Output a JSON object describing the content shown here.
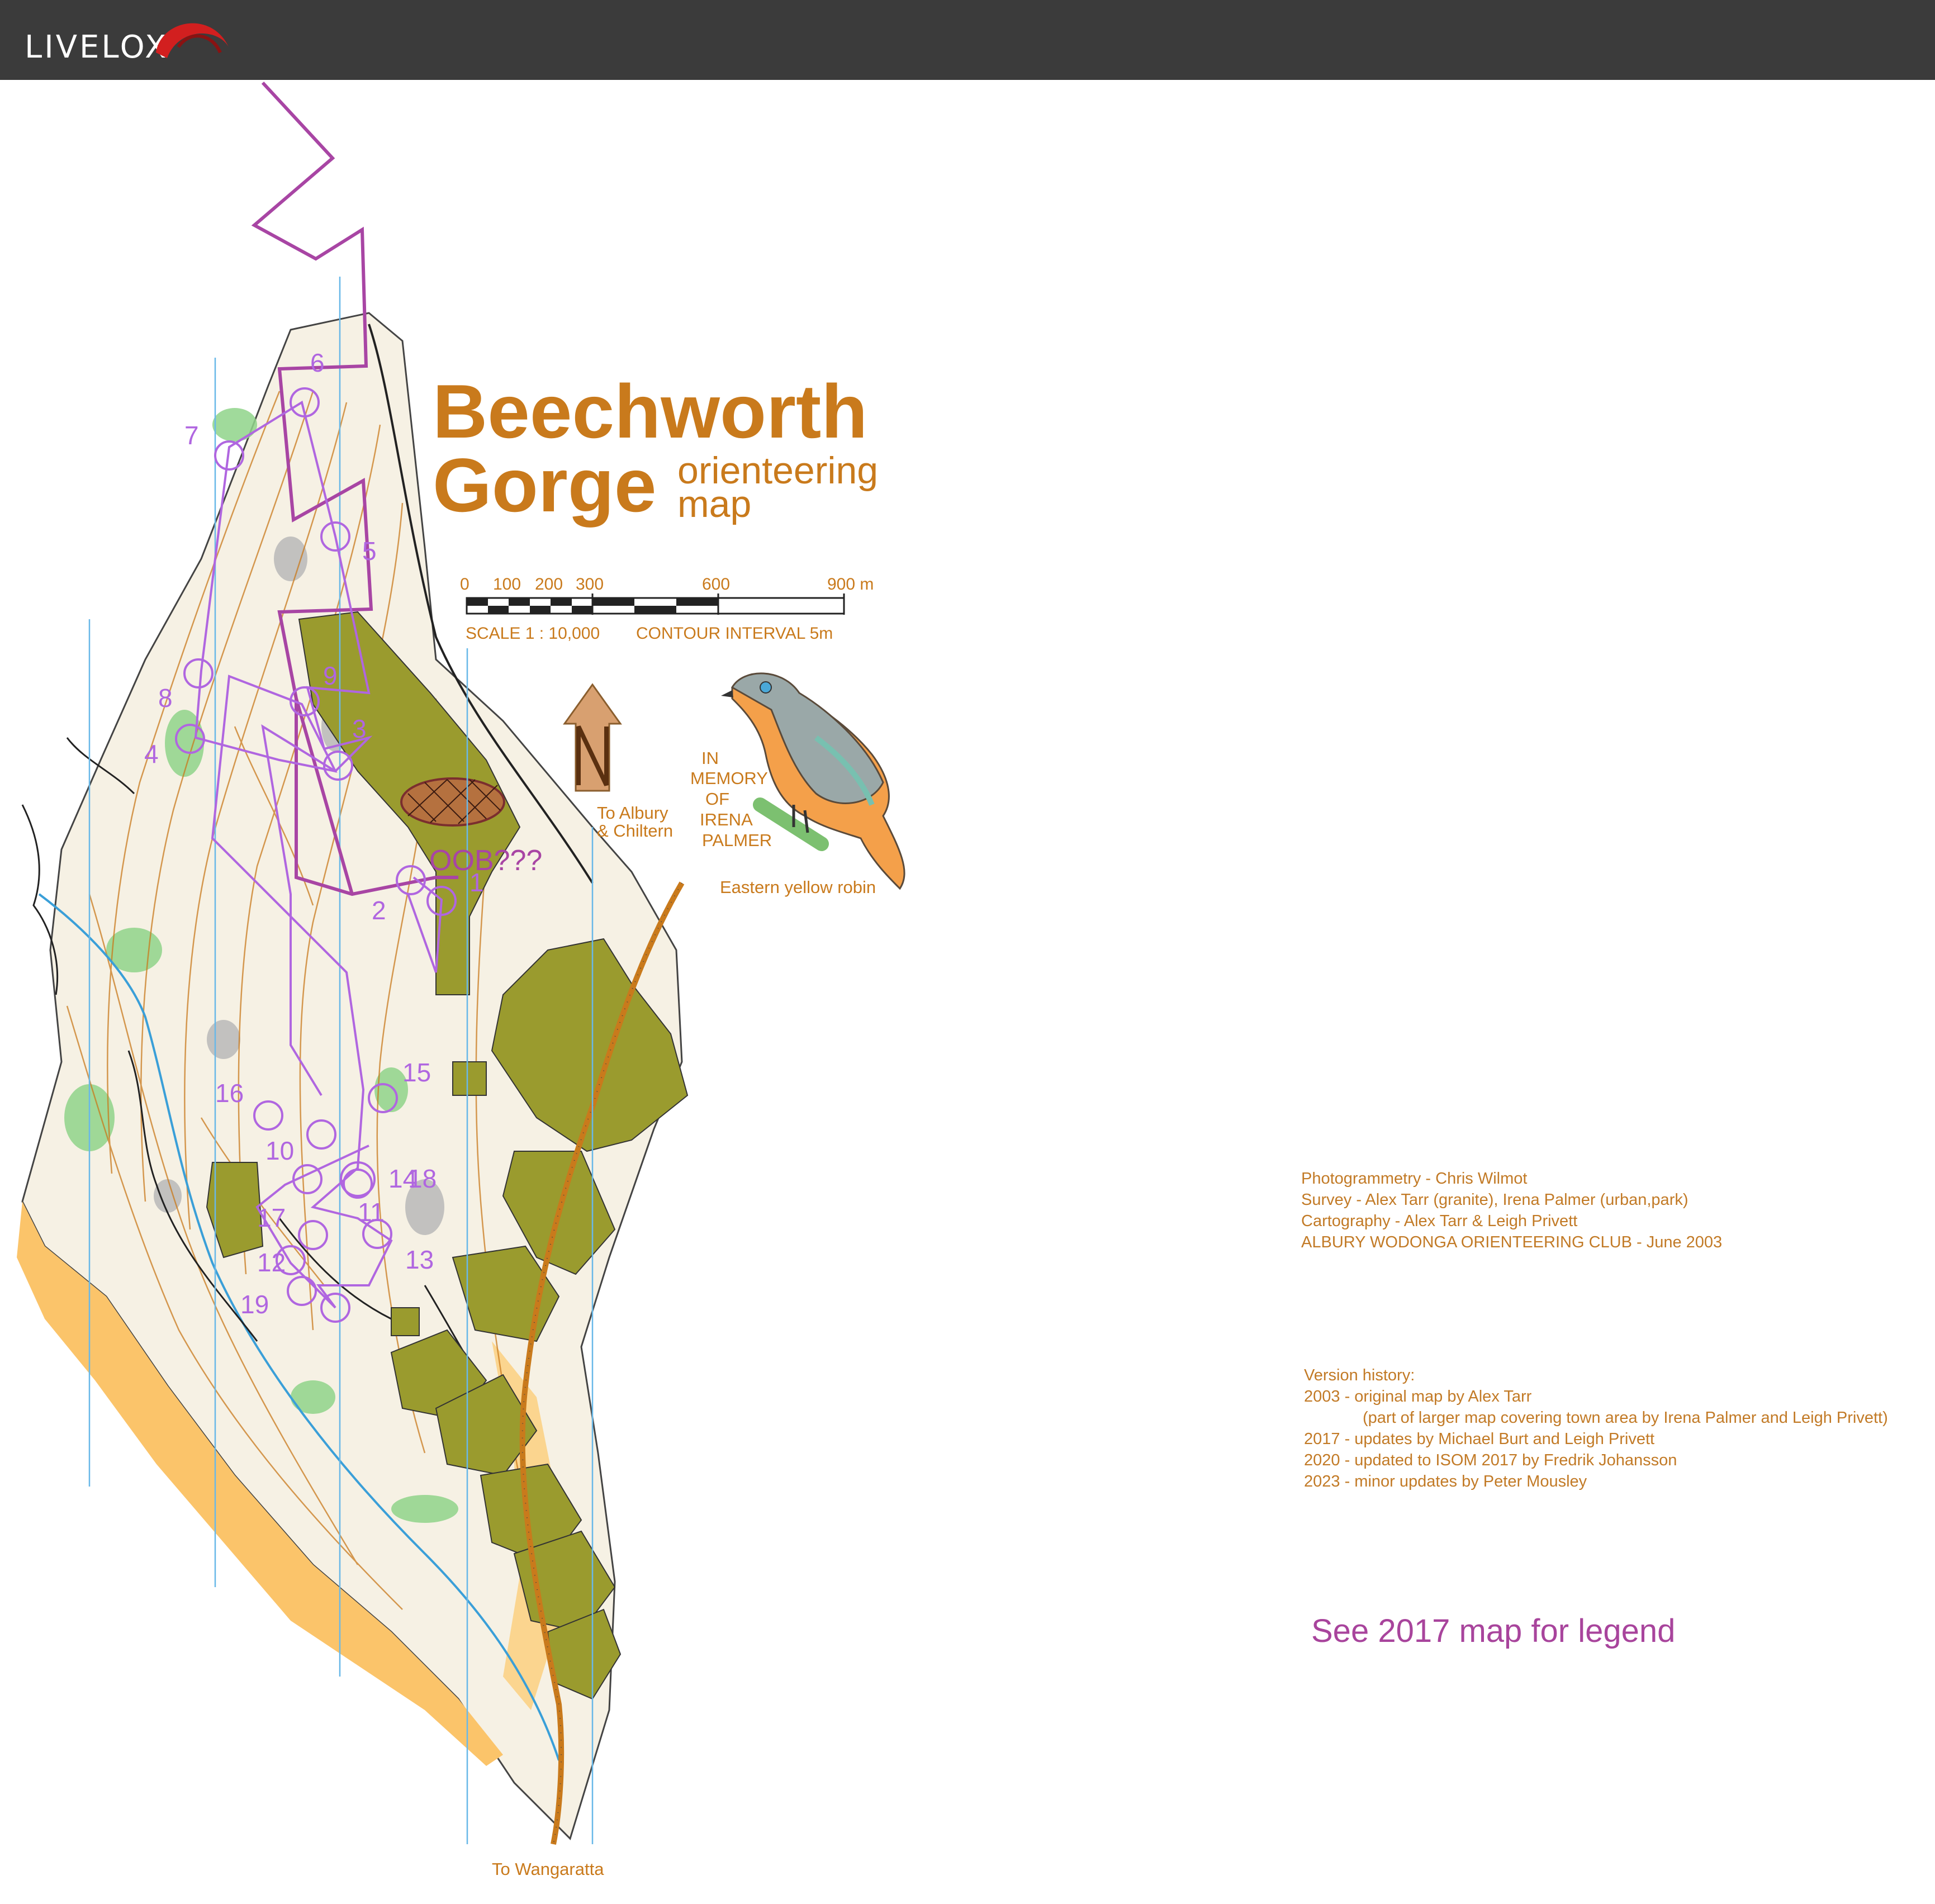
{
  "app": {
    "name": "LIVELOX",
    "colors": {
      "topbar": "#3b3b3b",
      "logo_text": "#ffffff",
      "logo_swoosh": "#d21f1f"
    }
  },
  "map": {
    "title_line1": "Beechworth",
    "title_line2": "Gorge",
    "subtitle_line1": "orienteering",
    "subtitle_line2": "map",
    "scale_ticks": [
      "0",
      "100",
      "200",
      "300",
      "600",
      "900 m"
    ],
    "scale_text": "SCALE   1 : 10,000",
    "contour_text": "CONTOUR   INTERVAL     5m",
    "to_albury": [
      "To Albury",
      "& Chiltern"
    ],
    "to_wangaratta": "To Wangaratta",
    "memorial": [
      "IN",
      "MEMORY",
      "OF",
      "IRENA",
      "PALMER"
    ],
    "bird_caption": "Eastern yellow robin",
    "oob_label": "OOB???",
    "control_labels": [
      "1",
      "2",
      "3",
      "4",
      "5",
      "6",
      "7",
      "8",
      "9",
      "10",
      "11",
      "12",
      "13",
      "14",
      "15",
      "16",
      "17",
      "18",
      "19"
    ],
    "colors": {
      "brand_orange": "#c97a1c",
      "course_purple": "#a845a4",
      "olive": "#9a9b2e",
      "open_land": "#fbc46a",
      "forest_green": "#78c878",
      "magnetic_north": "#68b8e8"
    }
  },
  "credits": {
    "lines": [
      "Photogrammetry - Chris Wilmot",
      "Survey - Alex Tarr (granite), Irena Palmer (urban,park)",
      "Cartography - Alex Tarr & Leigh Privett",
      "ALBURY WODONGA ORIENTEERING CLUB - June 2003"
    ]
  },
  "history": {
    "lines": [
      "Version history:",
      "2003 - original map by Alex Tarr",
      "(part of larger map covering town area by Irena Palmer and Leigh Privett)",
      "2017 - updates by Michael Burt and Leigh Privett",
      "2020 - updated to ISOM 2017 by Fredrik Johansson",
      "2023 - minor updates by Peter Mousley"
    ]
  },
  "legend_note": "See 2017 map for legend"
}
